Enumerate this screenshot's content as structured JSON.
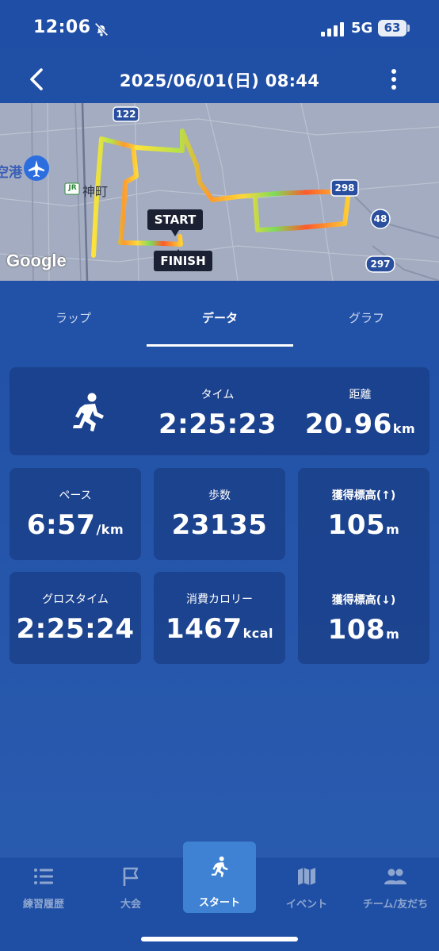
{
  "status_bar": {
    "time": "12:06",
    "network": "5G",
    "battery": "63",
    "icons": [
      "bell-slash-icon",
      "signal-icon"
    ]
  },
  "header": {
    "title": "2025/06/01(日) 08:44",
    "back_icon": "chevron-left-icon",
    "more_icon": "more-vertical-icon"
  },
  "map": {
    "labels": {
      "start": "START",
      "finish": "FINISH",
      "station": "神町",
      "station_badge": "JR",
      "airport_partial": "空港",
      "google": "Google"
    },
    "route_shields": [
      "122",
      "298",
      "48",
      "297"
    ]
  },
  "tabs": [
    {
      "label": "ラップ",
      "active": false
    },
    {
      "label": "データ",
      "active": true
    },
    {
      "label": "グラフ",
      "active": false
    }
  ],
  "stats": {
    "activity_icon": "running-person-icon",
    "time": {
      "label": "タイム",
      "value": "2:25:23"
    },
    "distance": {
      "label": "距離",
      "value": "20.96",
      "unit": "km"
    },
    "pace": {
      "label": "ペース",
      "value": "6:57",
      "unit": "/km"
    },
    "steps": {
      "label": "歩数",
      "value": "23135"
    },
    "gross_time": {
      "label": "グロスタイム",
      "value": "2:25:24"
    },
    "calories": {
      "label": "消費カロリー",
      "value": "1467",
      "unit": "kcal"
    },
    "elevation_gain": {
      "label": "獲得標高(↑)",
      "value": "105",
      "unit": "m"
    },
    "elevation_loss": {
      "label": "獲得標高(↓)",
      "value": "108",
      "unit": "m"
    }
  },
  "bottom_nav": [
    {
      "label": "練習履歴",
      "icon": "list-icon",
      "active": false
    },
    {
      "label": "大会",
      "icon": "flag-icon",
      "active": false
    },
    {
      "label": "スタート",
      "icon": "running-person-icon",
      "active": true
    },
    {
      "label": "イベント",
      "icon": "map-icon",
      "active": false
    },
    {
      "label": "チーム/友だち",
      "icon": "people-icon",
      "active": false
    }
  ],
  "colors": {
    "background": "#2353a8",
    "card": "#1a3f8f",
    "active_nav": "#3f82d3",
    "route_low": "#ffe23b",
    "route_mid": "#a0e04a",
    "route_high": "#ff4a2a"
  }
}
